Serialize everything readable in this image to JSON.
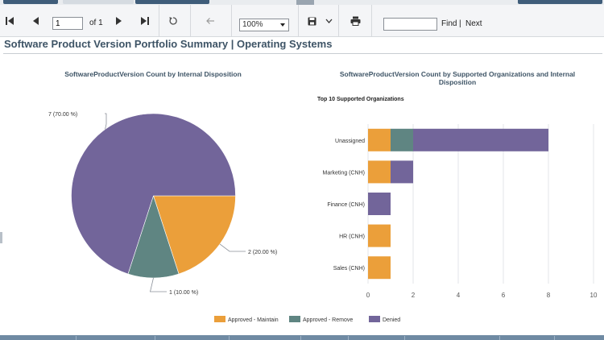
{
  "toolbar": {
    "page_value": "1",
    "of_label": "of",
    "page_total": "1",
    "zoom": "100%",
    "find_label": "Find",
    "find_separator": "|",
    "next_label": "Next",
    "icons": [
      "first-page-icon",
      "previous-page-icon",
      "next-page-icon",
      "last-page-icon",
      "refresh-icon",
      "back-icon",
      "save-icon",
      "chevron-down-icon",
      "print-icon"
    ]
  },
  "report": {
    "title": "Software Product Version Portfolio Summary | Operating Systems"
  },
  "chart_data": [
    {
      "type": "pie",
      "title": "SoftwareProductVersion  Count by Internal Disposition",
      "slices": [
        {
          "category": "Approved - Maintain",
          "value": 2,
          "label": "2 (20.00 %)",
          "color": "#eb9f3a"
        },
        {
          "category": "Approved - Remove",
          "value": 1,
          "label": "1 (10.00 %)",
          "color": "#5f8582"
        },
        {
          "category": "Denied",
          "value": 7,
          "label": "7 (70.00 %)",
          "color": "#72659a"
        }
      ]
    },
    {
      "type": "bar",
      "orientation": "horizontal",
      "stacked": true,
      "title": "SoftwareProductVersion Count by Supported Organizations and Internal Disposition",
      "subtitle": "Top 10 Supported Organizations",
      "categories": [
        "Unassigned",
        "Marketing (CNH)",
        "Finance (CNH)",
        "HR (CNH)",
        "Sales (CNH)"
      ],
      "series": [
        {
          "name": "Approved - Maintain",
          "color": "#eb9f3a",
          "values": [
            1,
            1,
            0,
            1,
            1
          ]
        },
        {
          "name": "Approved - Remove",
          "color": "#5f8582",
          "values": [
            1,
            0,
            0,
            0,
            0
          ]
        },
        {
          "name": "Denied",
          "color": "#72659a",
          "values": [
            6,
            1,
            1,
            0,
            0
          ]
        }
      ],
      "xlim": [
        0,
        10
      ],
      "xticks": [
        "0",
        "2",
        "4",
        "6",
        "8",
        "10"
      ],
      "grid": true
    }
  ],
  "legend": {
    "placement": "bottom",
    "items": [
      {
        "label": "Approved - Maintain",
        "color": "#eb9f3a"
      },
      {
        "label": "Approved - Remove",
        "color": "#5f8582"
      },
      {
        "label": "Denied",
        "color": "#72659a"
      }
    ]
  }
}
